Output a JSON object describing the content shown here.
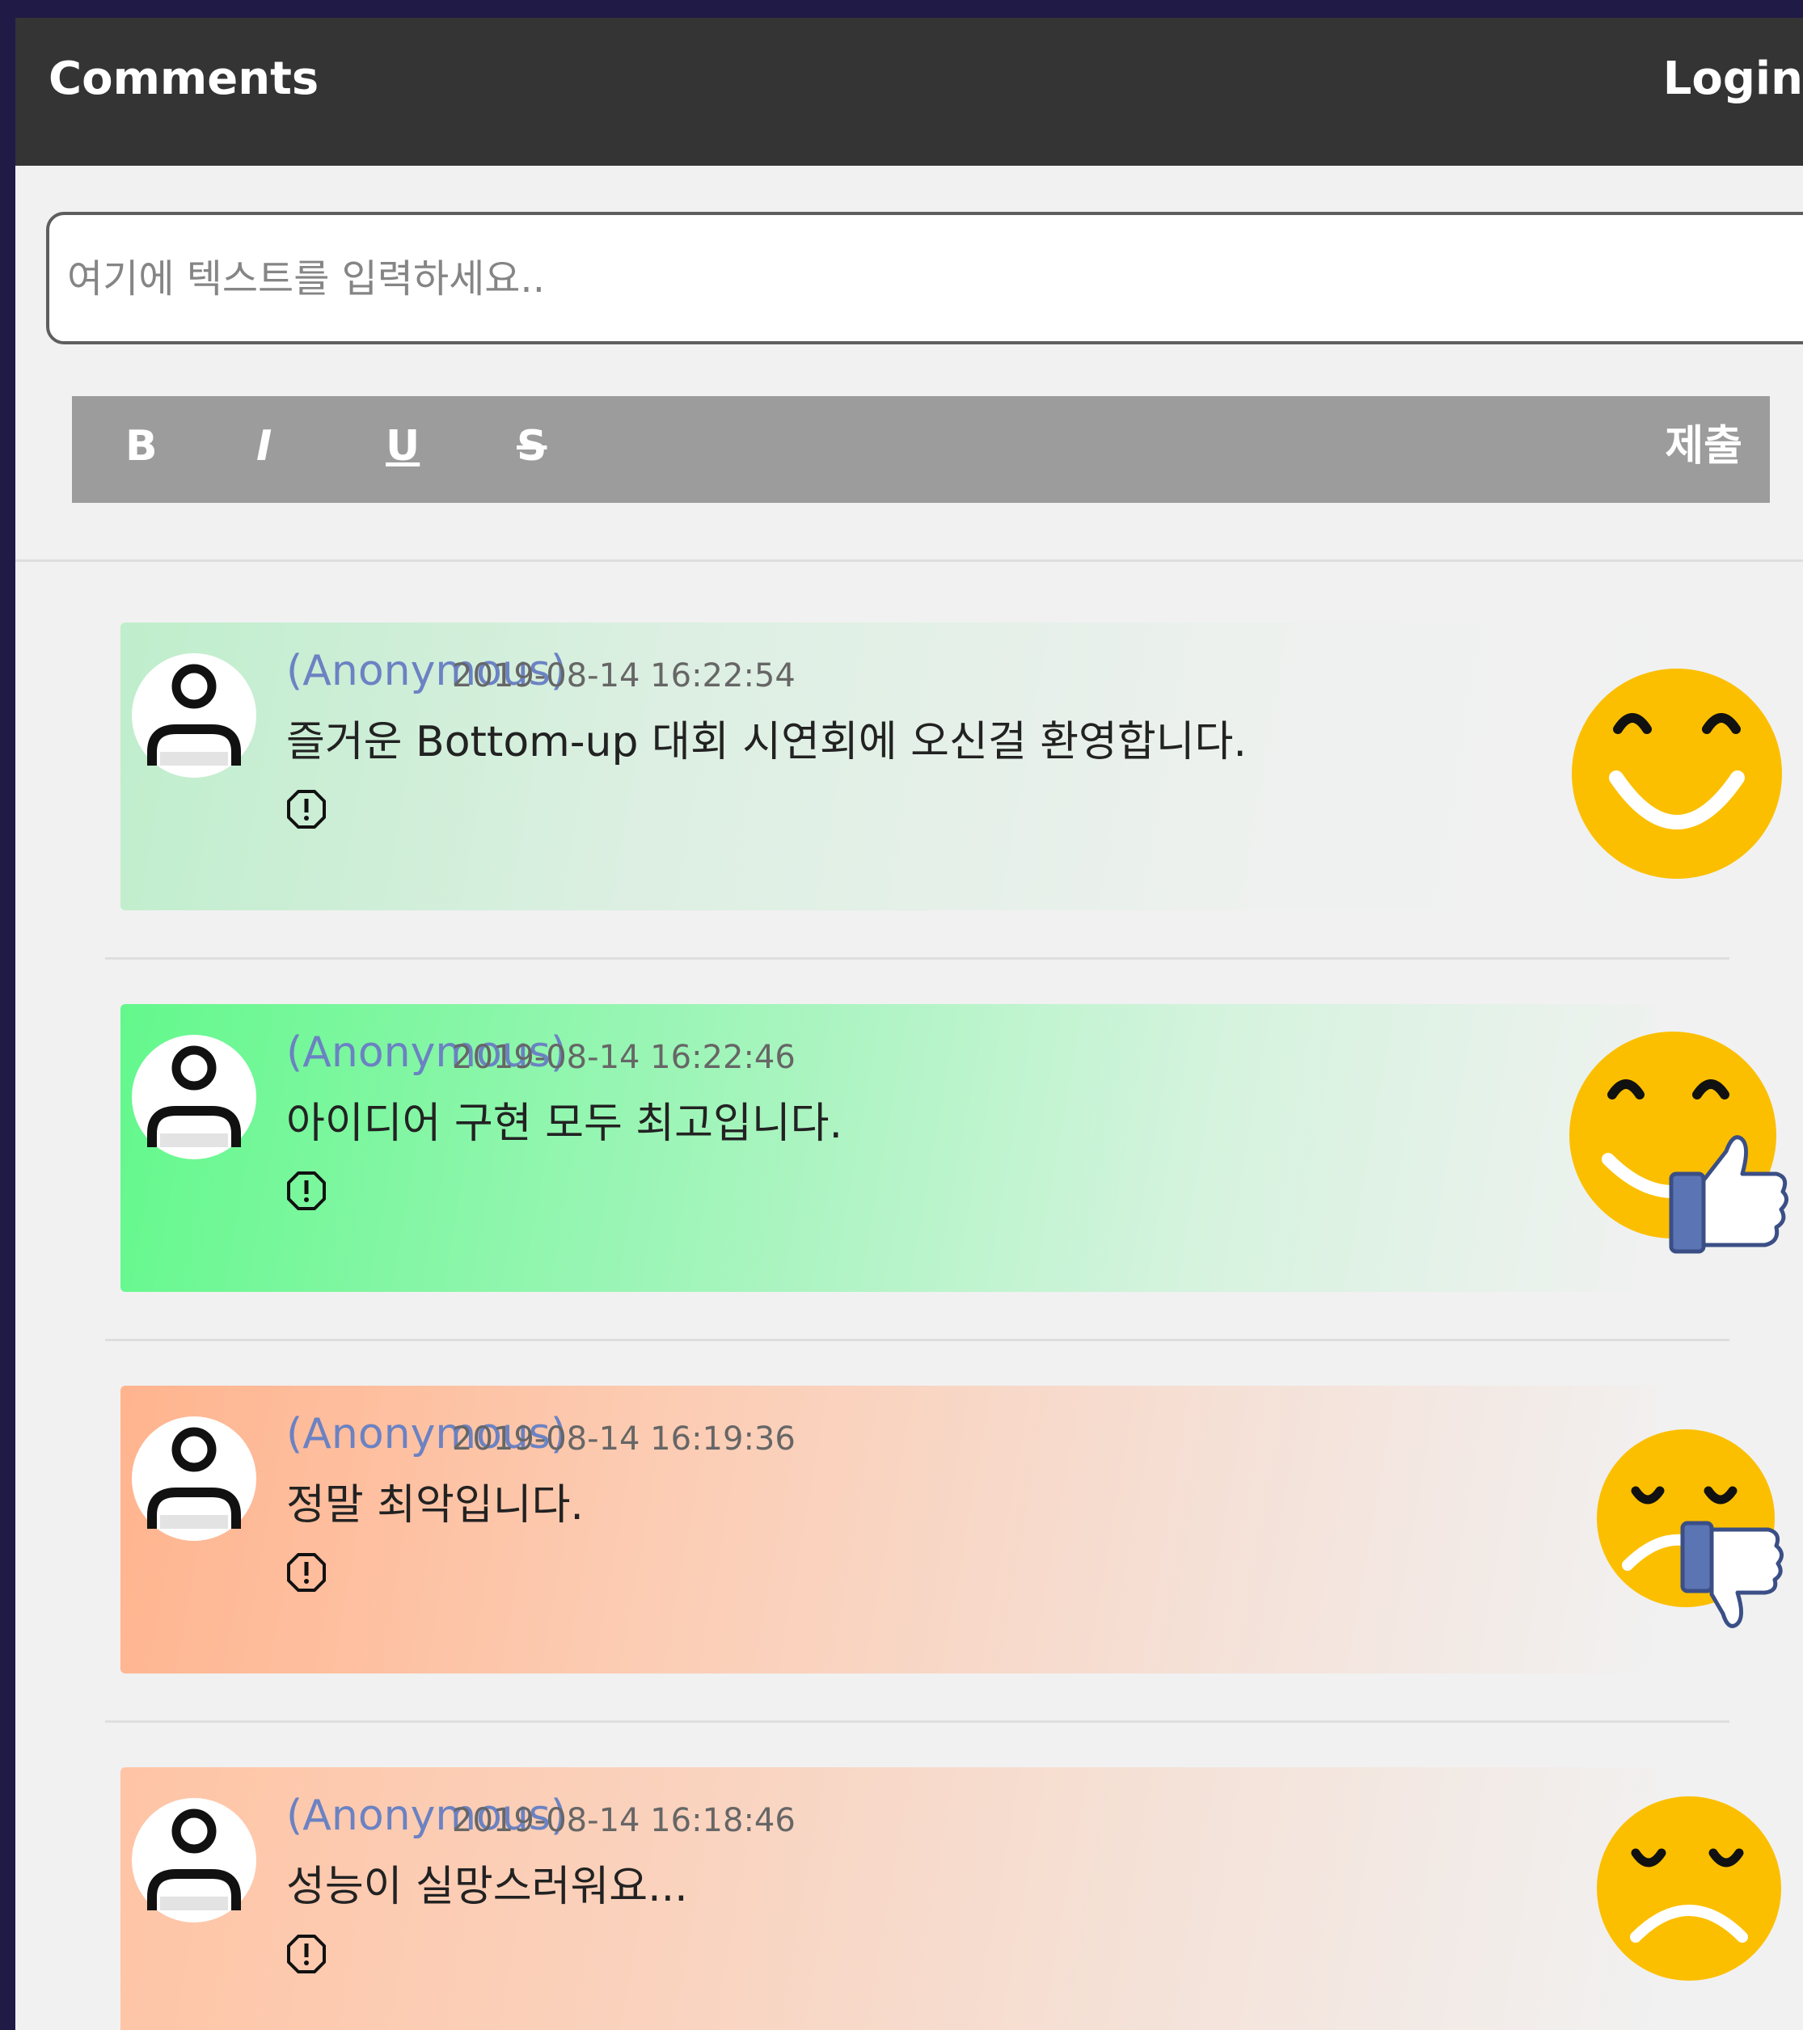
{
  "header": {
    "title": "Comments",
    "login_label": "Login"
  },
  "composer": {
    "placeholder": "여기에 텍스트를 입력하세요..",
    "bold_label": "B",
    "italic_label": "I",
    "underline_label": "U",
    "strike_label": "S",
    "submit_label": "제출"
  },
  "comments": [
    {
      "author": "(Anonymous)",
      "timestamp": "2019-08-14 16:22:54",
      "text": "즐거운 Bottom-up 대회 시연회에 오신걸 환영합니다.",
      "emoji": "happy-face-icon",
      "background": "#bfeecc"
    },
    {
      "author": "(Anonymous)",
      "timestamp": "2019-08-14 16:22:46",
      "text": "아이디어 구현 모두 최고입니다.",
      "emoji": "thumbs-up-face-icon",
      "background": "#63f88c"
    },
    {
      "author": "(Anonymous)",
      "timestamp": "2019-08-14 16:19:36",
      "text": "정말 최악입니다.",
      "emoji": "thumbs-down-face-icon",
      "background": "#ffb48e"
    },
    {
      "author": "(Anonymous)",
      "timestamp": "2019-08-14 16:18:46",
      "text": "성능이 실망스러워요...",
      "emoji": "sad-face-icon",
      "background": "#ffc4a5"
    }
  ],
  "colors": {
    "page_bg": "#201a46",
    "topbar": "#343434",
    "toolbar": "#9c9c9c",
    "author": "#6b82c3",
    "emoji_yellow": "#fbbf00"
  }
}
